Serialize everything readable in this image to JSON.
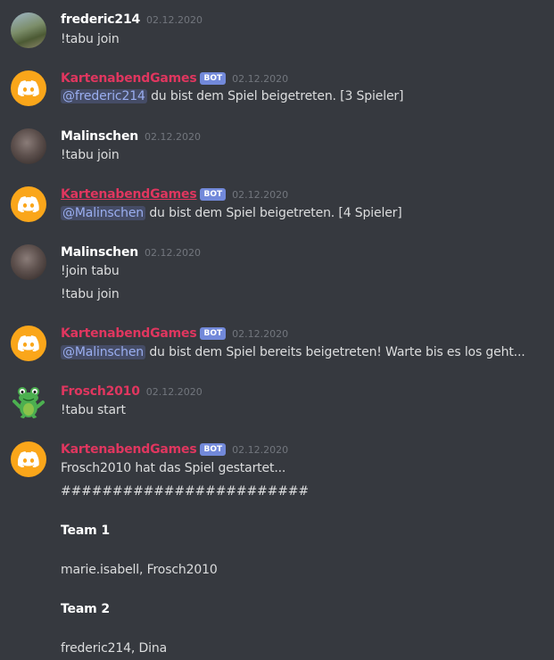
{
  "messages": [
    {
      "author": "frederic214",
      "timestamp": "02.12.2020",
      "lines": [
        "!tabu join"
      ]
    },
    {
      "author": "KartenabendGames",
      "badge": "BOT",
      "timestamp": "02.12.2020",
      "mention": "@frederic214",
      "text": " du bist dem Spiel beigetreten. [3 Spieler]"
    },
    {
      "author": "Malinschen",
      "timestamp": "02.12.2020",
      "lines": [
        "!tabu join"
      ]
    },
    {
      "author": "KartenabendGames",
      "badge": "BOT",
      "timestamp": "02.12.2020",
      "mention": "@Malinschen",
      "text": " du bist dem Spiel beigetreten. [4 Spieler]"
    },
    {
      "author": "Malinschen",
      "timestamp": "02.12.2020",
      "lines": [
        "!join tabu",
        "!tabu join"
      ]
    },
    {
      "author": "KartenabendGames",
      "badge": "BOT",
      "timestamp": "02.12.2020",
      "mention": "@Malinschen",
      "text": " du bist dem Spiel bereits beigetreten! Warte bis es los geht..."
    },
    {
      "author": "Frosch2010",
      "timestamp": "02.12.2020",
      "lines": [
        "!tabu start"
      ]
    },
    {
      "author": "KartenabendGames",
      "badge": "BOT",
      "timestamp": "02.12.2020",
      "lines": [
        "Frosch2010 hat das Spiel gestartet...",
        "########################",
        "Team 1",
        "marie.isabell, Frosch2010",
        "Team 2",
        "frederic214, Dina"
      ]
    }
  ],
  "colors": {
    "background": "#36393f",
    "bot_name": "#e0365f",
    "badge": "#7289da",
    "bot_avatar": "#faa61a"
  },
  "icons": {
    "bot_avatar": "discord-logo-icon",
    "frog_avatar": "frog-icon"
  }
}
